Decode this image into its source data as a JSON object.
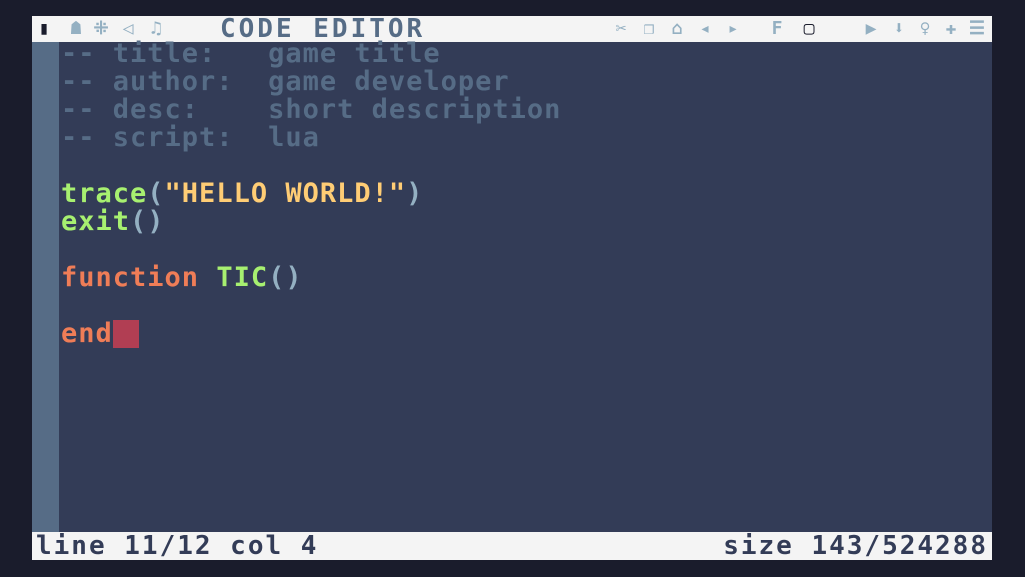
{
  "window": {
    "title": "CODE EDITOR"
  },
  "toolbar": {
    "left_icons": [
      {
        "name": "code-editor-tab",
        "glyph": "▮"
      },
      {
        "name": "sprite-editor-tab",
        "glyph": "☗"
      },
      {
        "name": "map-editor-tab",
        "glyph": "⁜"
      },
      {
        "name": "sfx-editor-tab",
        "glyph": "◁"
      },
      {
        "name": "music-editor-tab",
        "glyph": "♫"
      }
    ],
    "right_icons": [
      {
        "name": "cut-icon",
        "glyph": "✂"
      },
      {
        "name": "copy-icon",
        "glyph": "❐"
      },
      {
        "name": "paste-icon",
        "glyph": "⌂"
      },
      {
        "name": "undo-icon",
        "glyph": "◂"
      },
      {
        "name": "redo-icon",
        "glyph": "▸"
      },
      {
        "name": "find-icon",
        "glyph": "F"
      },
      {
        "name": "goto-icon",
        "glyph": "▢"
      },
      {
        "name": "run-icon",
        "glyph": "▶"
      },
      {
        "name": "bookmark-icon",
        "glyph": "⬇"
      },
      {
        "name": "outline-icon",
        "glyph": "♀"
      },
      {
        "name": "zoom-icon",
        "glyph": "✚"
      },
      {
        "name": "menu-icon",
        "glyph": "☰"
      }
    ]
  },
  "code": {
    "line1_prefix": "-- title:",
    "line1_value": "game title",
    "line2_prefix": "-- author:",
    "line2_value": "game developer",
    "line3_prefix": "-- desc:",
    "line3_value": "short description",
    "line4_prefix": "-- script:",
    "line4_value": "lua",
    "line6_func": "trace",
    "line6_open": "(",
    "line6_string": "\"HELLO WORLD!\"",
    "line6_close": ")",
    "line7_func": "exit",
    "line7_parens": "()",
    "line9_keyword": "function",
    "line9_name": "TIC",
    "line9_parens": "()",
    "line11_keyword": "end"
  },
  "status": {
    "position": "line 11/12 col 4",
    "size": "size 143/524288"
  },
  "colors": {
    "background": "#333c57",
    "comment": "#566c86",
    "function": "#a7f070",
    "string": "#ffcd75",
    "keyword": "#ef7d57",
    "cursor": "#b13e53",
    "bar": "#f4f4f4"
  }
}
